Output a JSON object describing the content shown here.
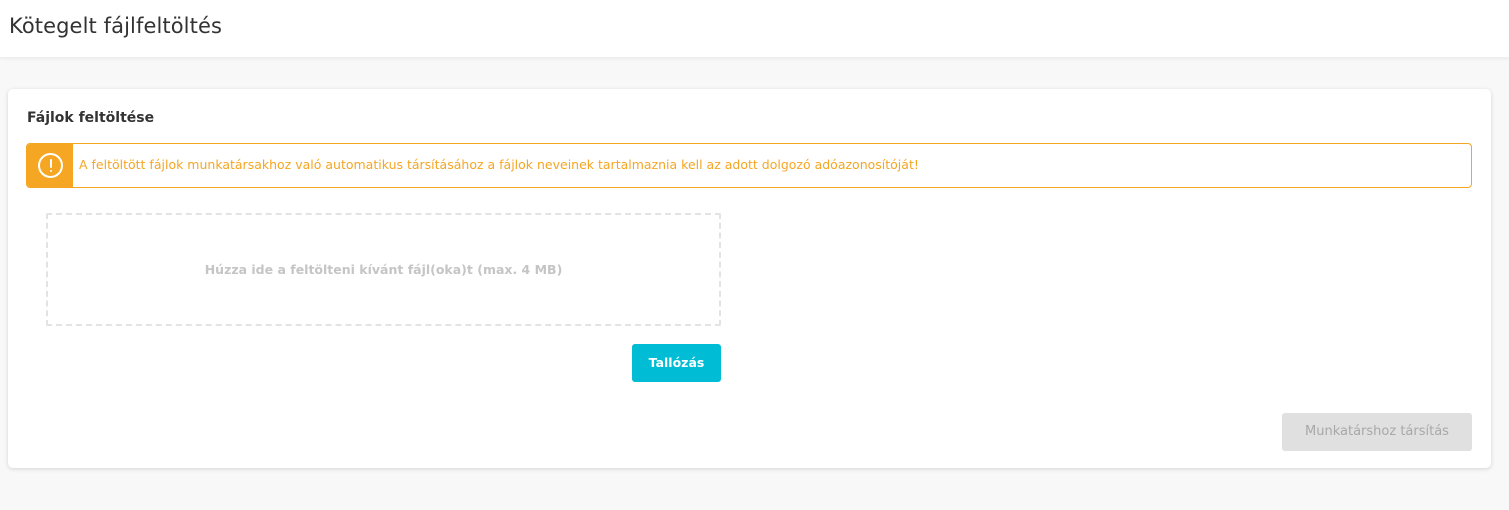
{
  "header": {
    "title": "Kötegelt fájlfeltöltés"
  },
  "card": {
    "title": "Fájlok feltöltése",
    "alert": {
      "icon": "exclamation-circle-icon",
      "text": "A feltöltött fájlok munkatársakhoz való automatikus társításához a fájlok neveinek tartalmaznia kell az adott dolgozó adóazonosítóját!",
      "color": "#f5a623"
    },
    "dropzone": {
      "text": "Húzza ide a feltölteni kívánt fájl(oka)t (max. 4 MB)"
    },
    "browse_label": "Tallózás",
    "assign_label": "Munkatárshoz társítás"
  },
  "colors": {
    "accent": "#00bcd4",
    "warning": "#f5a623",
    "disabled_bg": "#e0e0e0"
  }
}
